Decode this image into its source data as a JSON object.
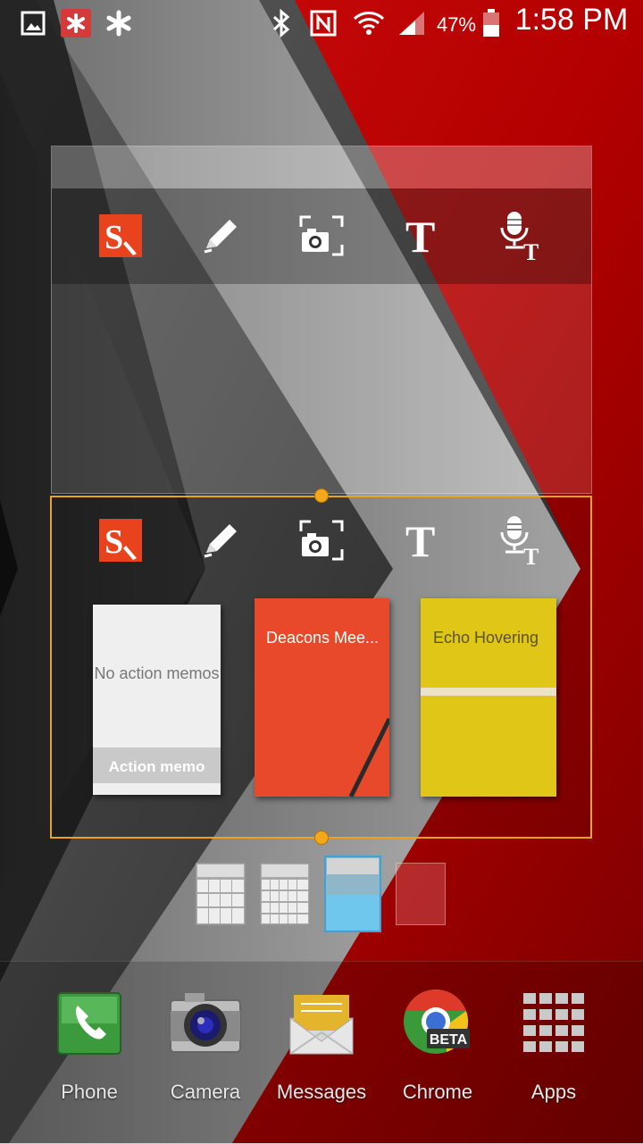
{
  "status_bar": {
    "battery_percent": "47%",
    "time": "1:58 PM",
    "left_icons": [
      "gallery-icon",
      "app-notification-icon",
      "asterisk-icon"
    ],
    "right_icons": [
      "bluetooth-icon",
      "nfc-icon",
      "wifi-icon",
      "signal-icon",
      "battery-icon"
    ]
  },
  "widget_top": {
    "tools": [
      "snote-icon",
      "pen-icon",
      "screen-capture-icon",
      "text-icon",
      "voice-text-icon"
    ]
  },
  "widget_bottom": {
    "tools": [
      "snote-icon",
      "pen-icon",
      "screen-capture-icon",
      "text-icon",
      "voice-text-icon"
    ],
    "memos": [
      {
        "message": "No action memos",
        "label": "Action memo"
      },
      {
        "title": "Deacons Mee..."
      },
      {
        "title": "Echo Hovering"
      }
    ]
  },
  "widget_sizes": {
    "selected_index": 2
  },
  "dock": {
    "apps": [
      {
        "label": "Phone",
        "icon": "phone-icon"
      },
      {
        "label": "Camera",
        "icon": "camera-icon"
      },
      {
        "label": "Messages",
        "icon": "messages-icon"
      },
      {
        "label": "Chrome",
        "icon": "chrome-icon",
        "badge": "BETA"
      },
      {
        "label": "Apps",
        "icon": "apps-grid-icon"
      }
    ]
  },
  "colors": {
    "accent_orange": "#f2a81a",
    "wallpaper_red": "#c00a0a",
    "memo_red": "#e8492a",
    "memo_yellow": "#e0c617"
  }
}
